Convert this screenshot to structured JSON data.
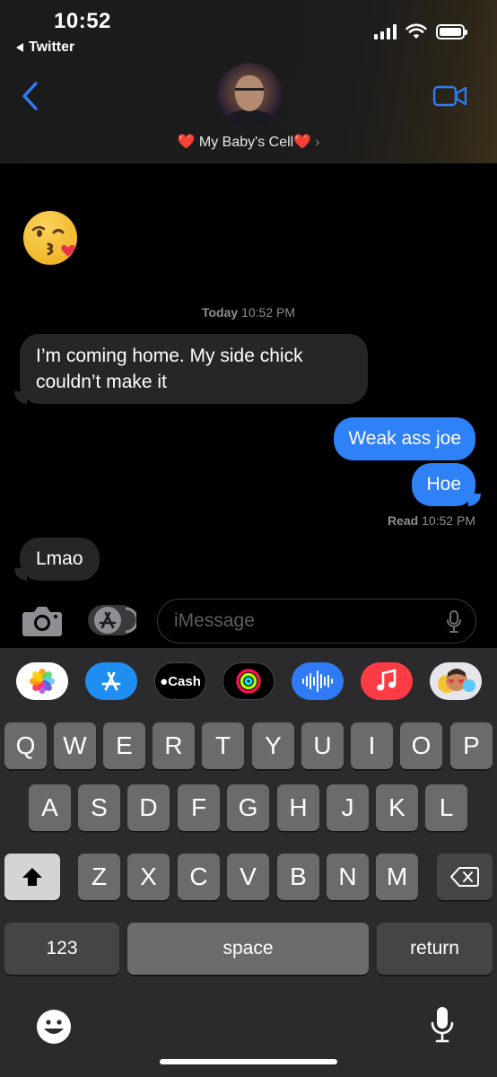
{
  "status_bar": {
    "time": "10:52",
    "back_app": "Twitter"
  },
  "header": {
    "contact_name": "❤️ My Baby's Cell❤️",
    "chevron": "›"
  },
  "conversation": {
    "sticker_emoji": "😘",
    "timestamp_day": "Today",
    "timestamp_time": "10:52 PM",
    "messages": [
      {
        "direction": "incoming",
        "text": "I’m coming home. My side chick couldn’t make it"
      },
      {
        "direction": "outgoing",
        "text": "Weak ass joe"
      },
      {
        "direction": "outgoing",
        "text": "Hoe"
      },
      {
        "direction": "incoming",
        "text": "Lmao"
      }
    ],
    "read_label": "Read",
    "read_time": "10:52 PM"
  },
  "input_bar": {
    "placeholder": "iMessage"
  },
  "app_strip": {
    "items": [
      "photos-icon",
      "app-store-icon",
      "apple-cash-icon",
      "activity-icon",
      "audio-message-icon",
      "music-icon",
      "memoji-icon"
    ],
    "cash_label": "Cash"
  },
  "keyboard": {
    "row1": [
      "Q",
      "W",
      "E",
      "R",
      "T",
      "Y",
      "U",
      "I",
      "O",
      "P"
    ],
    "row2": [
      "A",
      "S",
      "D",
      "F",
      "G",
      "H",
      "J",
      "K",
      "L"
    ],
    "row3": [
      "Z",
      "X",
      "C",
      "V",
      "B",
      "N",
      "M"
    ],
    "numbers_key": "123",
    "space_key": "space",
    "return_key": "return"
  },
  "colors": {
    "outgoing_bubble": "#2f81f7",
    "incoming_bubble": "#262628",
    "accent": "#2f7bf6"
  }
}
